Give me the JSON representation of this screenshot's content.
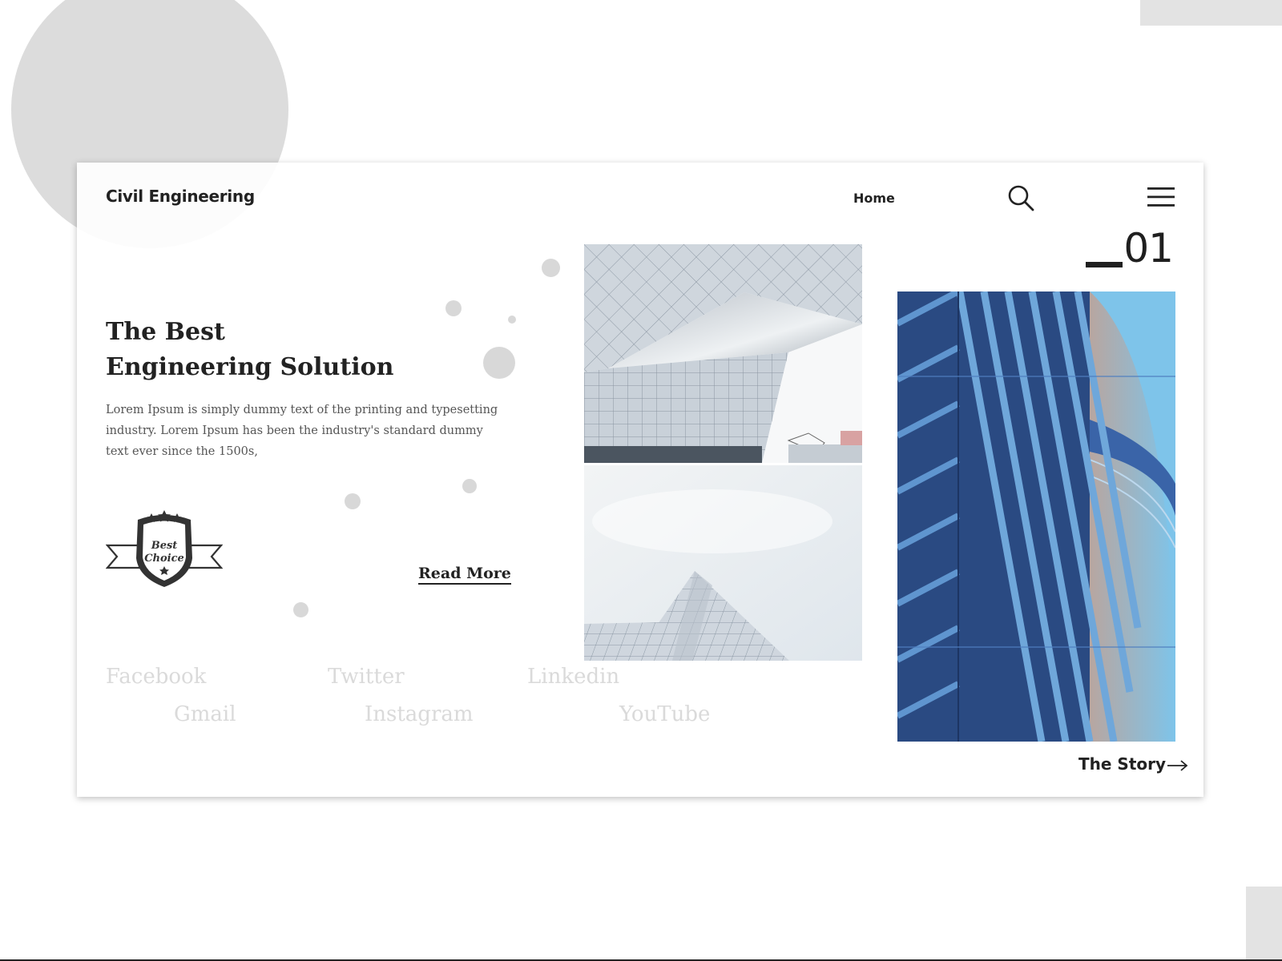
{
  "header": {
    "brand": "Civil Engineering",
    "nav_home": "Home",
    "search_icon": "search-icon",
    "menu_icon": "hamburger-menu-icon"
  },
  "slide": {
    "number": "01"
  },
  "hero": {
    "title_line1": "The Best",
    "title_line2": "Engineering Solution",
    "body": "Lorem Ipsum is simply dummy text of the printing and typesetting industry. Lorem Ipsum has been the industry's standard dummy text ever since the 1500s,",
    "read_more": "Read More"
  },
  "badge": {
    "line1": "Best",
    "line2": "Choice",
    "icon": "best-choice-badge"
  },
  "social": [
    "Facebook",
    "Twitter",
    "Linkedin",
    "Gmail",
    "Instagram",
    "YouTube"
  ],
  "story": {
    "label": "The Story",
    "icon": "arrow-right-icon"
  },
  "colors": {
    "text_dark": "#222222",
    "muted_text": "#555555",
    "social_text": "#dadada",
    "decor_gray": "#dcdcdc",
    "building_blue": "#27477f",
    "sky_blue": "#7ec4ea"
  }
}
